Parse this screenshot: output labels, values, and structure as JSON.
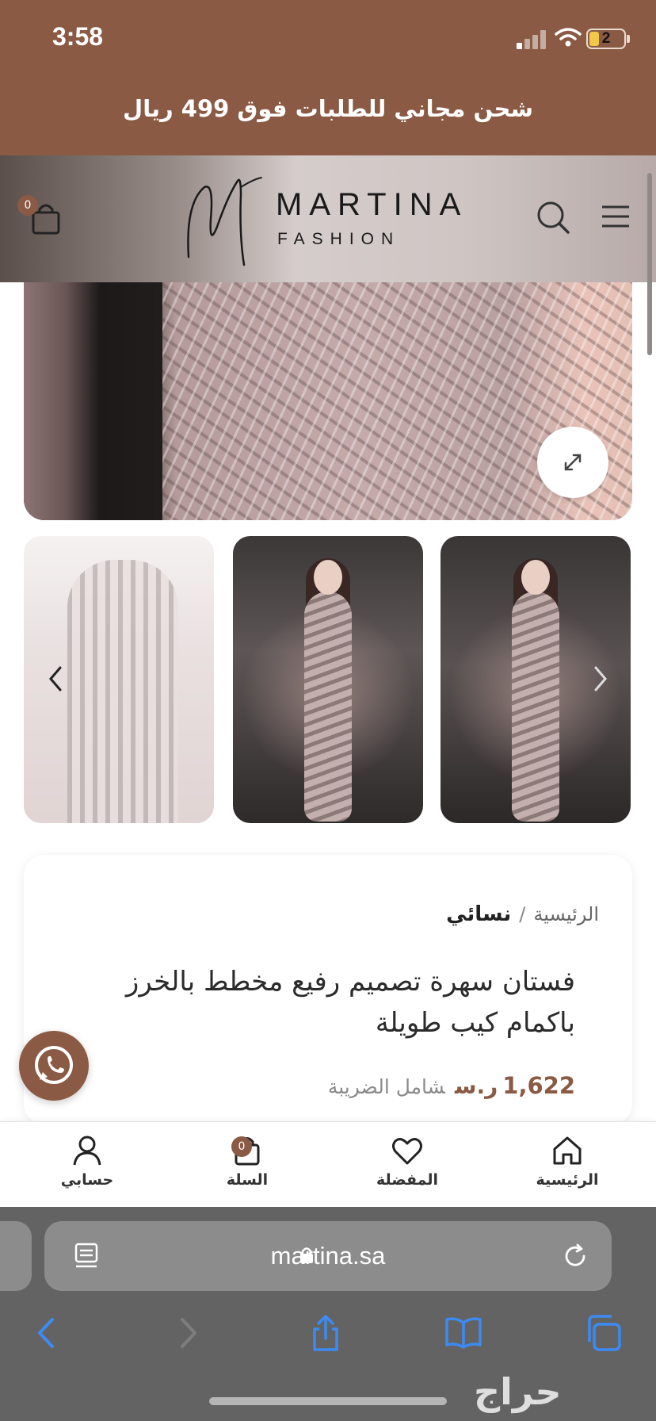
{
  "status_bar": {
    "time": "3:58",
    "battery": "2"
  },
  "promo": {
    "text": "شحن مجاني للطلبات فوق 499 ريال"
  },
  "header": {
    "cart_count": "0",
    "logo_title": "MARTINA",
    "logo_subtitle": "FASHION",
    "icons": [
      "cart-icon",
      "search-icon",
      "menu-icon"
    ]
  },
  "gallery": {
    "main_image": "dress-closeup",
    "thumbnails": [
      "dress-front-closeup",
      "dress-full-model-left",
      "dress-full-model-right"
    ]
  },
  "product": {
    "breadcrumb_home": "الرئيسية",
    "breadcrumb_separator": "/",
    "breadcrumb_current": "نسائي",
    "title": "فستان سهرة تصميم رفيع مخطط بالخرز باكمام كيب طويلة",
    "price": "1,622",
    "currency": "ر.س",
    "tax_note": "شامل الضريبة"
  },
  "bottom_nav": {
    "home": "الرئيسية",
    "favorites": "المفضلة",
    "cart": "السلة",
    "cart_count": "0",
    "account": "حسابي"
  },
  "browser": {
    "url": "martina.sa"
  },
  "watermark": {
    "text": "حراج"
  },
  "colors": {
    "brand": "#8a5a44",
    "safari_bar": "#636363",
    "link_blue": "#3d8bf2"
  }
}
